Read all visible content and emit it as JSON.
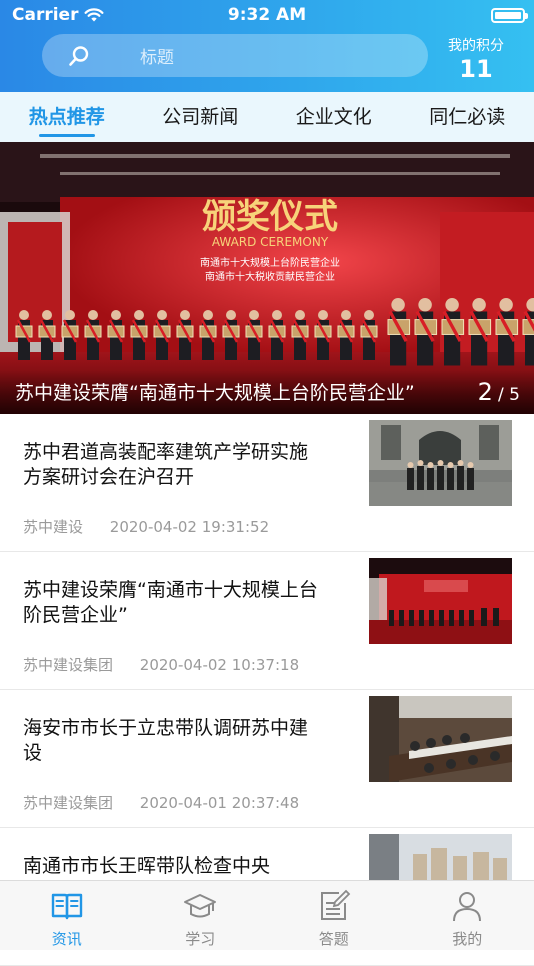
{
  "status_bar": {
    "carrier": "Carrier",
    "time": "9:32 AM"
  },
  "search": {
    "placeholder": "标题"
  },
  "points": {
    "label": "我的积分",
    "value": "11"
  },
  "tabs": [
    {
      "label": "热点推荐",
      "active": true
    },
    {
      "label": "公司新闻",
      "active": false
    },
    {
      "label": "企业文化",
      "active": false
    },
    {
      "label": "同仁必读",
      "active": false
    }
  ],
  "banner": {
    "caption": "苏中建设荣膺“南通市十大规模上台阶民营企业”",
    "page_current": "2",
    "page_total": "/ 5",
    "photo_text": {
      "heading": "颁奖仪式",
      "subheading": "AWARD CEREMONY",
      "line1": "南通市十大规模上台阶民营企业",
      "line2": "南通市十大税收贡献民营企业"
    }
  },
  "news": [
    {
      "title": "苏中君道高装配率建筑产学研实施方案研讨会在沪召开",
      "source": "苏中建设",
      "datetime": "2020-04-02 19:31:52"
    },
    {
      "title": "苏中建设荣膺“南通市十大规模上台阶民营企业”",
      "source": "苏中建设集团",
      "datetime": "2020-04-02 10:37:18"
    },
    {
      "title": "海安市市长于立忠带队调研苏中建设",
      "source": "苏中建设集团",
      "datetime": "2020-04-01 20:37:48"
    },
    {
      "title": "南通市市长王晖带队检查中央",
      "source": "",
      "datetime": ""
    }
  ],
  "tabbar": [
    {
      "label": "资讯",
      "icon": "book-icon",
      "active": true
    },
    {
      "label": "学习",
      "icon": "graduation-cap-icon",
      "active": false
    },
    {
      "label": "答题",
      "icon": "edit-icon",
      "active": false
    },
    {
      "label": "我的",
      "icon": "person-icon",
      "active": false
    }
  ],
  "colors": {
    "accent": "#2196e6",
    "header_start": "#2a88e6",
    "header_end": "#35c0f1"
  }
}
